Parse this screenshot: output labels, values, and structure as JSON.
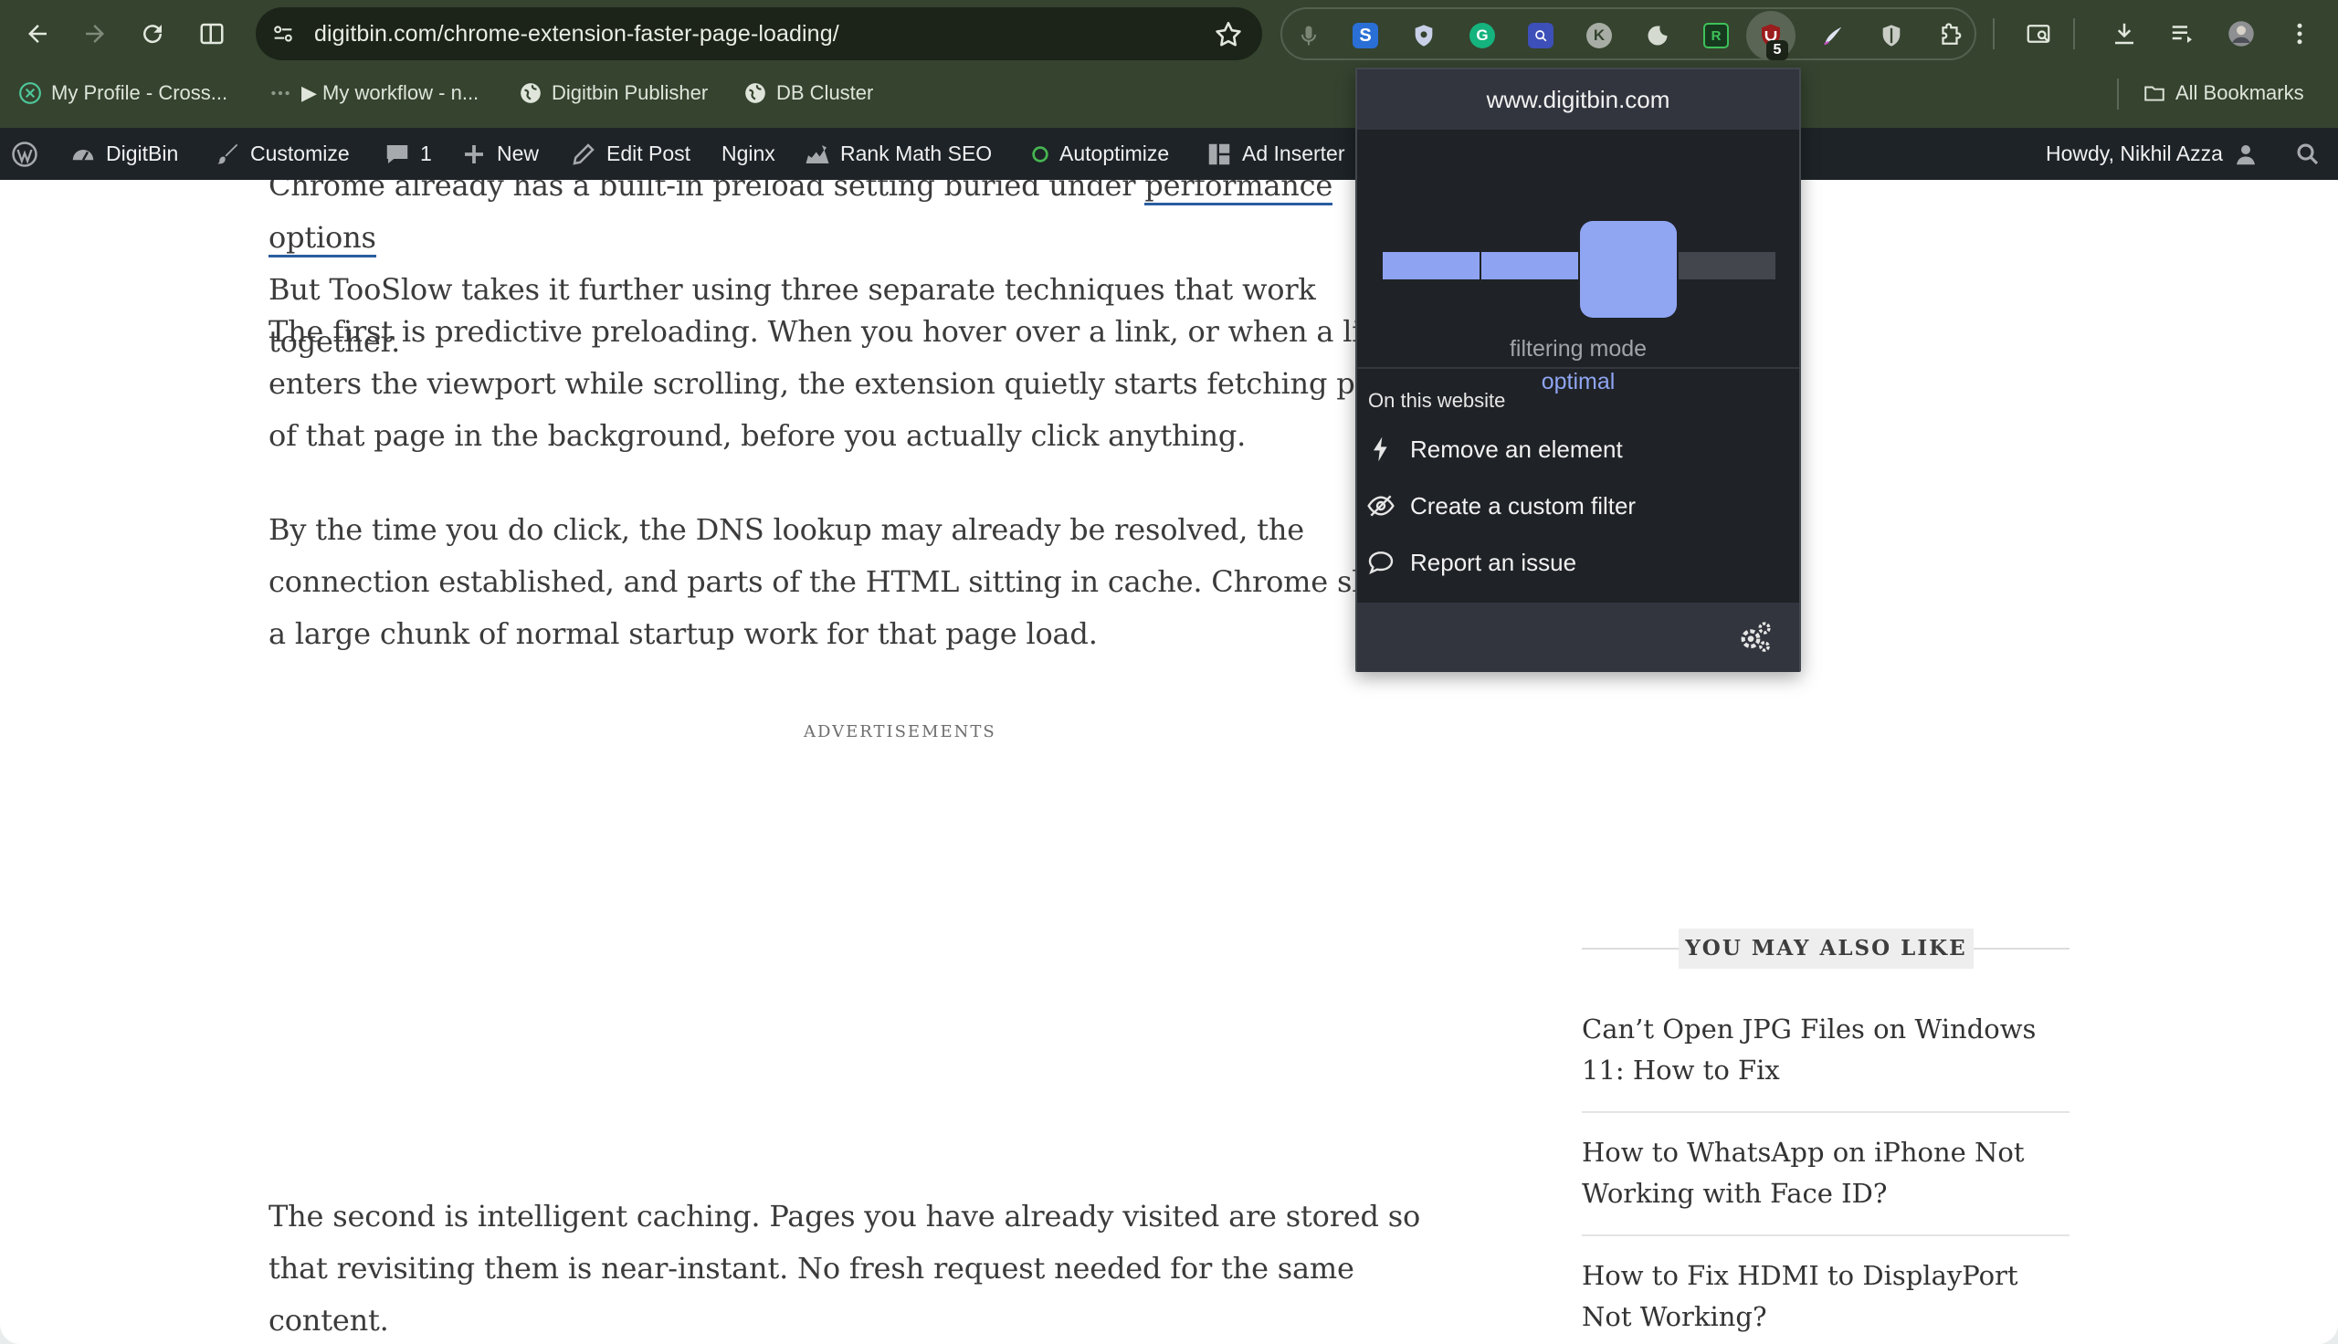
{
  "toolbar": {
    "url": "digitbin.com/chrome-extension-faster-page-loading/"
  },
  "extensions": {
    "ublock_badge": "5",
    "icons": [
      "microphone-icon",
      "s-extension-icon",
      "shield-extension-icon",
      "grammarly-icon",
      "search-extension-icon",
      "k-extension-icon",
      "darkmode-extension-icon",
      "r-extension-icon",
      "ublock-origin-icon",
      "pen-extension-icon",
      "bitwarden-icon",
      "puzzle-icon"
    ]
  },
  "bookmarks": {
    "items": [
      "My Profile - Cross...",
      "▶ My workflow - n...",
      "Digitbin Publisher",
      "DB Cluster"
    ],
    "all_bookmarks": "All Bookmarks"
  },
  "adminbar": {
    "site_name": "DigitBin",
    "customize": "Customize",
    "comments_count": "1",
    "new": "New",
    "edit_post": "Edit Post",
    "nginx": "Nginx",
    "rank_math": "Rank Math SEO",
    "autoptimize": "Autoptimize",
    "ad_inserter": "Ad Inserter",
    "howdy": "Howdy, Nikhil Azza"
  },
  "article": {
    "p1_line1_before": "Chrome already has a built-in preload setting buried under ",
    "p1_link": "performance options",
    "p1_line2": "But TooSlow takes it further using three separate techniques that work together.",
    "p2": "The first is predictive preloading. When you hover over a link, or when a link enters the viewport while scrolling, the extension quietly starts fetching parts of that page in the background, before you actually click anything.",
    "p3": "By the time you do click, the DNS lookup may already be resolved, the connection established, and parts of the HTML sitting in cache. Chrome skips a large chunk of normal startup work for that page load.",
    "ads_label": "ADVERTISEMENTS",
    "p4": "The second is intelligent caching. Pages you have already visited are stored so that revisiting them is near-instant. No fresh request needed for the same content."
  },
  "sidebar": {
    "title": "YOU MAY ALSO LIKE",
    "related": [
      "Can’t Open JPG Files on Windows 11: How to Fix",
      "How to WhatsApp on iPhone Not Working with Face ID?",
      "How to Fix HDMI to DisplayPort Not Working?"
    ]
  },
  "popup": {
    "hostname": "www.digitbin.com",
    "filter_level": 0.625,
    "filter_label": "filtering mode",
    "filter_value": "optimal",
    "section_title": "On this website",
    "items": [
      "Remove an element",
      "Create a custom filter",
      "Report an issue"
    ]
  },
  "colors": {
    "toolbar": "#35432f",
    "adminbar": "#1d2327",
    "popup_accent": "#8fa5f2",
    "popup_bg": "#1f2226"
  }
}
